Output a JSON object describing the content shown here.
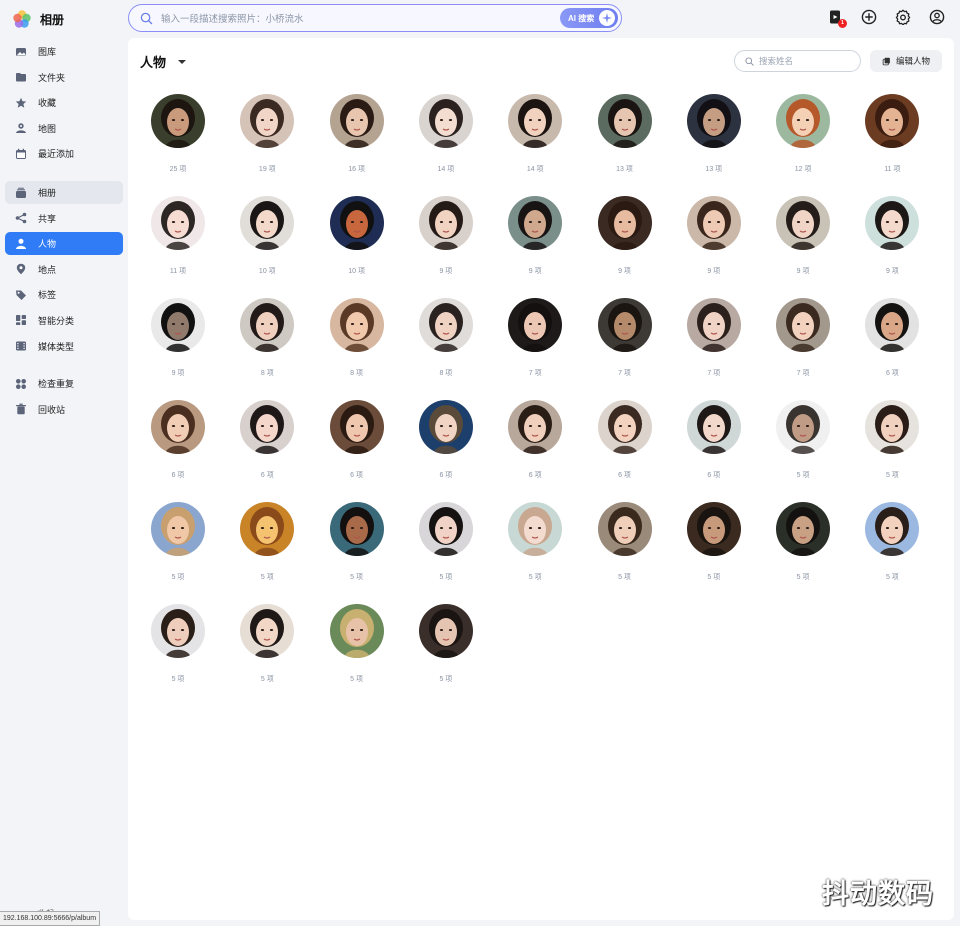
{
  "app": {
    "name": "相册"
  },
  "search": {
    "placeholder": "输入一段描述搜索照片：小桥流水",
    "ai_label": "AI 搜索"
  },
  "top_icons": [
    {
      "name": "upload-icon",
      "badge": "1"
    },
    {
      "name": "add-icon"
    },
    {
      "name": "settings-icon"
    },
    {
      "name": "account-icon"
    }
  ],
  "sidebar": {
    "group1": [
      {
        "id": "gallery",
        "label": "图库",
        "icon": "gallery-icon"
      },
      {
        "id": "folder",
        "label": "文件夹",
        "icon": "folder-icon"
      },
      {
        "id": "favorites",
        "label": "收藏",
        "icon": "star-icon"
      },
      {
        "id": "map",
        "label": "地图",
        "icon": "map-icon"
      },
      {
        "id": "recent",
        "label": "最近添加",
        "icon": "calendar-icon"
      }
    ],
    "group2": [
      {
        "id": "albums",
        "label": "相册",
        "icon": "album-icon",
        "state": "highlight"
      },
      {
        "id": "shared",
        "label": "共享",
        "icon": "share-icon"
      },
      {
        "id": "people",
        "label": "人物",
        "icon": "person-icon",
        "state": "active"
      },
      {
        "id": "places",
        "label": "地点",
        "icon": "location-icon"
      },
      {
        "id": "tags",
        "label": "标签",
        "icon": "tag-icon"
      },
      {
        "id": "smart",
        "label": "智能分类",
        "icon": "smart-category-icon"
      },
      {
        "id": "media",
        "label": "媒体类型",
        "icon": "media-type-icon"
      }
    ],
    "group3": [
      {
        "id": "dupes",
        "label": "检查重复",
        "icon": "duplicate-icon"
      },
      {
        "id": "trash",
        "label": "回收站",
        "icon": "trash-icon"
      }
    ],
    "cut_label": "收起",
    "status_url": "192.168.100.89:5666/p/album"
  },
  "main": {
    "title": "人物",
    "name_search_placeholder": "搜索姓名",
    "edit_label": "编辑人物",
    "people": [
      {
        "count": "25 项",
        "bg": "#3a3f2d",
        "skin": "#c99a7c",
        "hair": "#1d1610"
      },
      {
        "count": "19 项",
        "bg": "#d6c3b8",
        "skin": "#f1d6c8",
        "hair": "#3b2a22"
      },
      {
        "count": "16 项",
        "bg": "#b5a392",
        "skin": "#e8c5ae",
        "hair": "#2a1c14"
      },
      {
        "count": "14 项",
        "bg": "#d9d4cf",
        "skin": "#f2ddd0",
        "hair": "#2b2220"
      },
      {
        "count": "14 项",
        "bg": "#c8b9ad",
        "skin": "#f0d2bf",
        "hair": "#1c1410"
      },
      {
        "count": "13 项",
        "bg": "#5b6b60",
        "skin": "#e6c6b1",
        "hair": "#1a1512"
      },
      {
        "count": "13 项",
        "bg": "#2d3240",
        "skin": "#c59d83",
        "hair": "#121014"
      },
      {
        "count": "12 项",
        "bg": "#9cb9a0",
        "skin": "#f4d0b5",
        "hair": "#b5582a"
      },
      {
        "count": "11 项",
        "bg": "#6b3c22",
        "skin": "#e4b393",
        "hair": "#3a1d10"
      },
      {
        "count": "11 项",
        "bg": "#efe7e8",
        "skin": "#f6dcd2",
        "hair": "#2c2624"
      },
      {
        "count": "10 项",
        "bg": "#e1ddd8",
        "skin": "#f3d9ca",
        "hair": "#1a1616"
      },
      {
        "count": "10 项",
        "bg": "#1f2d55",
        "skin": "#c8663d",
        "hair": "#111111"
      },
      {
        "count": "9 项",
        "bg": "#d8d0ca",
        "skin": "#f1d3c2",
        "hair": "#241a16"
      },
      {
        "count": "9 项",
        "bg": "#7a8f8a",
        "skin": "#cfa88e",
        "hair": "#181414"
      },
      {
        "count": "9 项",
        "bg": "#3b2a22",
        "skin": "#e7bba0",
        "hair": "#2a1a12"
      },
      {
        "count": "9 项",
        "bg": "#cbb8a8",
        "skin": "#eec9b3",
        "hair": "#3a261c"
      },
      {
        "count": "9 项",
        "bg": "#c9c2b6",
        "skin": "#f0d5c6",
        "hair": "#241c18"
      },
      {
        "count": "9 项",
        "bg": "#cde0dc",
        "skin": "#f4dacd",
        "hair": "#1c1816"
      },
      {
        "count": "9 项",
        "bg": "#e9e9ea",
        "skin": "#8f7a6c",
        "hair": "#111111"
      },
      {
        "count": "8 项",
        "bg": "#cfc9c3",
        "skin": "#efd0bf",
        "hair": "#221a18"
      },
      {
        "count": "8 项",
        "bg": "#d8b7a0",
        "skin": "#f0c9ad",
        "hair": "#5a3a26"
      },
      {
        "count": "8 项",
        "bg": "#e0dcd9",
        "skin": "#f0d2c3",
        "hair": "#2a2220"
      },
      {
        "count": "7 项",
        "bg": "#1e1a1a",
        "skin": "#ecc8b4",
        "hair": "#141010"
      },
      {
        "count": "7 项",
        "bg": "#3d3a35",
        "skin": "#b58a6a",
        "hair": "#1b1512"
      },
      {
        "count": "7 项",
        "bg": "#b8aaa2",
        "skin": "#f0d3c5",
        "hair": "#2c201c"
      },
      {
        "count": "7 项",
        "bg": "#a3988c",
        "skin": "#f2d2bf",
        "hair": "#3b2a20"
      },
      {
        "count": "6 项",
        "bg": "#e2e2e2",
        "skin": "#d9a788",
        "hair": "#151212"
      },
      {
        "count": "6 项",
        "bg": "#b99a80",
        "skin": "#f1cdb5",
        "hair": "#4a2f20"
      },
      {
        "count": "6 项",
        "bg": "#d7d0cd",
        "skin": "#f4d6cb",
        "hair": "#1e1818"
      },
      {
        "count": "6 项",
        "bg": "#6b4b3a",
        "skin": "#efc6ae",
        "hair": "#2a1a12"
      },
      {
        "count": "6 项",
        "bg": "#1d3f6b",
        "skin": "#f1d4c4",
        "hair": "#5a4a3a"
      },
      {
        "count": "6 项",
        "bg": "#b8a79b",
        "skin": "#f0cfbd",
        "hair": "#2a1d16"
      },
      {
        "count": "6 项",
        "bg": "#dcd4cc",
        "skin": "#f3d3c0",
        "hair": "#3a2a22"
      },
      {
        "count": "6 项",
        "bg": "#cfd8d6",
        "skin": "#f2d7cb",
        "hair": "#1e1816"
      },
      {
        "count": "5 项",
        "bg": "#f0f0f0",
        "skin": "#c09b85",
        "hair": "#3a3430"
      },
      {
        "count": "5 项",
        "bg": "#e6e2de",
        "skin": "#f0d0be",
        "hair": "#2a1c16"
      },
      {
        "count": "5 项",
        "bg": "#8aa6cf",
        "skin": "#f0c8a8",
        "hair": "#c8a070"
      },
      {
        "count": "5 项",
        "bg": "#c98428",
        "skin": "#f5c270",
        "hair": "#8a4a1a"
      },
      {
        "count": "5 项",
        "bg": "#3a6a7a",
        "skin": "#a86a48",
        "hair": "#141010"
      },
      {
        "count": "5 项",
        "bg": "#d8d6d8",
        "skin": "#f0d3c6",
        "hair": "#161212"
      },
      {
        "count": "5 项",
        "bg": "#c8d8d4",
        "skin": "#f4dbd0",
        "hair": "#c8a890"
      },
      {
        "count": "5 项",
        "bg": "#9a8a7a",
        "skin": "#f0cfba",
        "hair": "#3a2a1e"
      },
      {
        "count": "5 项",
        "bg": "#3a2a20",
        "skin": "#c89a7c",
        "hair": "#1a1410"
      },
      {
        "count": "5 项",
        "bg": "#2a3028",
        "skin": "#c8a084",
        "hair": "#141210"
      },
      {
        "count": "5 项",
        "bg": "#9ab8e0",
        "skin": "#f2d2bf",
        "hair": "#2a1e18"
      },
      {
        "count": "5 项",
        "bg": "#e4e4e6",
        "skin": "#efcdbd",
        "hair": "#2a1e18"
      },
      {
        "count": "5 项",
        "bg": "#e6ddd4",
        "skin": "#f2d6c6",
        "hair": "#1e1816"
      },
      {
        "count": "5 项",
        "bg": "#6a8a5a",
        "skin": "#e8c2a8",
        "hair": "#c8b070"
      },
      {
        "count": "5 项",
        "bg": "#3a2e2a",
        "skin": "#e6c4b2",
        "hair": "#1a1412"
      }
    ]
  },
  "watermark": "抖动数码"
}
